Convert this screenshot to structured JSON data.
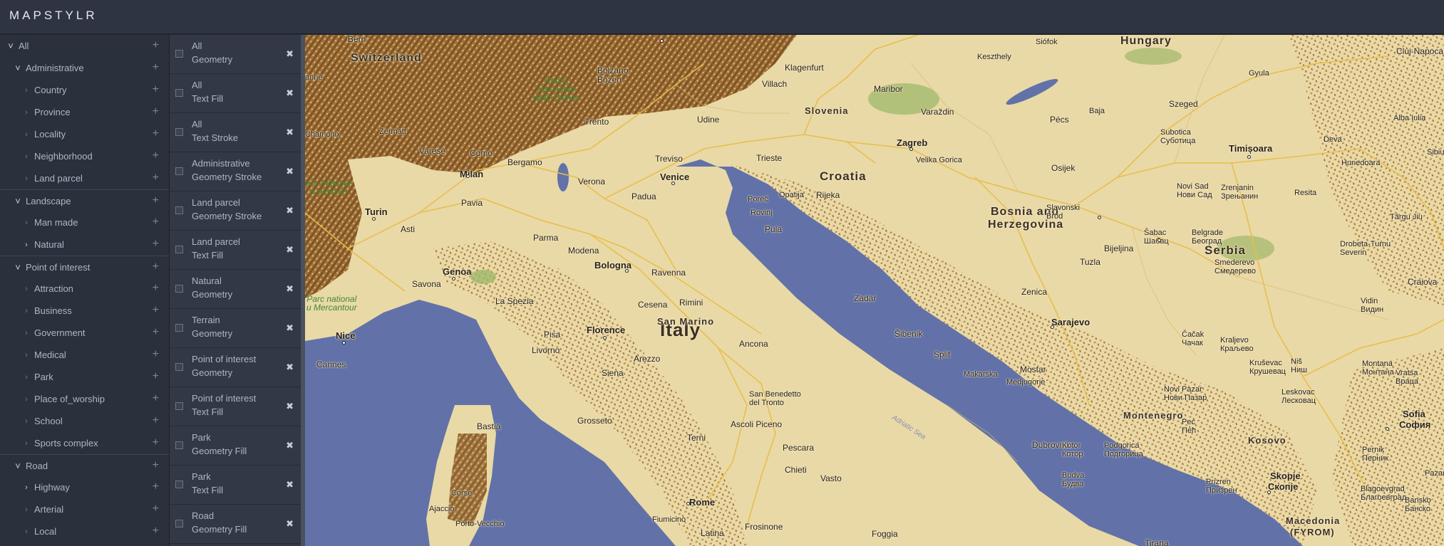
{
  "app": {
    "title": "MAPSTYLR"
  },
  "tree": [
    {
      "label": "All",
      "level": 0,
      "expanded": true,
      "sep": false
    },
    {
      "label": "Administrative",
      "level": 1,
      "expanded": true,
      "sep": false
    },
    {
      "label": "Country",
      "level": 2,
      "expanded": false,
      "sep": false
    },
    {
      "label": "Province",
      "level": 2,
      "expanded": false,
      "sep": false
    },
    {
      "label": "Locality",
      "level": 2,
      "expanded": false,
      "sep": false
    },
    {
      "label": "Neighborhood",
      "level": 2,
      "expanded": false,
      "sep": false
    },
    {
      "label": "Land parcel",
      "level": 2,
      "expanded": false,
      "sep": false
    },
    {
      "label": "Landscape",
      "level": 1,
      "expanded": true,
      "sep": true
    },
    {
      "label": "Man made",
      "level": 2,
      "expanded": false,
      "sep": false
    },
    {
      "label": "Natural",
      "level": 2,
      "expanded": false,
      "bright": true,
      "sep": false
    },
    {
      "label": "Point of interest",
      "level": 1,
      "expanded": true,
      "sep": true
    },
    {
      "label": "Attraction",
      "level": 2,
      "expanded": false,
      "sep": false
    },
    {
      "label": "Business",
      "level": 2,
      "expanded": false,
      "sep": false
    },
    {
      "label": "Government",
      "level": 2,
      "expanded": false,
      "sep": false
    },
    {
      "label": "Medical",
      "level": 2,
      "expanded": false,
      "sep": false
    },
    {
      "label": "Park",
      "level": 2,
      "expanded": false,
      "sep": false
    },
    {
      "label": "Place of_worship",
      "level": 2,
      "expanded": false,
      "sep": false
    },
    {
      "label": "School",
      "level": 2,
      "expanded": false,
      "sep": false
    },
    {
      "label": "Sports complex",
      "level": 2,
      "expanded": false,
      "sep": false
    },
    {
      "label": "Road",
      "level": 1,
      "expanded": true,
      "sep": true
    },
    {
      "label": "Highway",
      "level": 2,
      "expanded": false,
      "bright": true,
      "sep": false
    },
    {
      "label": "Arterial",
      "level": 2,
      "expanded": false,
      "sep": false
    },
    {
      "label": "Local",
      "level": 2,
      "expanded": false,
      "sep": false
    }
  ],
  "rules": [
    {
      "feature": "All",
      "element": "Geometry"
    },
    {
      "feature": "All",
      "element": "Text Fill"
    },
    {
      "feature": "All",
      "element": "Text Stroke"
    },
    {
      "feature": "Administrative",
      "element": "Geometry Stroke"
    },
    {
      "feature": "Land parcel",
      "element": "Geometry Stroke"
    },
    {
      "feature": "Land parcel",
      "element": "Text Fill"
    },
    {
      "feature": "Natural",
      "element": "Geometry"
    },
    {
      "feature": "Terrain",
      "element": "Geometry"
    },
    {
      "feature": "Point of interest",
      "element": "Geometry"
    },
    {
      "feature": "Point of interest",
      "element": "Text Fill"
    },
    {
      "feature": "Park",
      "element": "Geometry Fill"
    },
    {
      "feature": "Park",
      "element": "Text Fill"
    },
    {
      "feature": "Road",
      "element": "Geometry Fill"
    }
  ],
  "map": {
    "colors": {
      "land": "#e9d9a6",
      "water": "#6272a8",
      "terrain": "#9a6a36",
      "park": "#9fb86a",
      "road": "#e8bd4a"
    },
    "labels": {
      "hungary": "Hungary",
      "switzerland": "Switzerland",
      "slovenia": "Slovenia",
      "croatia": "Croatia",
      "bosnia1": "Bosnia and",
      "bosnia2": "Herzegovina",
      "serbia": "Serbia",
      "italy": "Italy",
      "montenegro": "Montenegro",
      "kosovo": "Kosovo",
      "macedonia1": "Macedonia",
      "macedonia2": "(FYROM)",
      "sanmarino": "San Marino",
      "bern": "Bern",
      "milan": "Milan",
      "turin": "Turin",
      "venice": "Venice",
      "genoa": "Genoa",
      "bologna": "Bologna",
      "florence": "Florence",
      "rome": "Rome",
      "nice": "Nice",
      "zagreb": "Zagreb",
      "sarajevo": "Sarajevo",
      "skopje": "Skopje",
      "skopje_cyr": "Скопје",
      "sofia": "Sofia",
      "sofia_cyr": "София",
      "timisoara": "Timișoara",
      "bastia": "Bastia",
      "ajaccio": "Ajaccio",
      "pisa": "Pisa",
      "livorno": "Livorno",
      "padua": "Padua",
      "verona": "Verona",
      "trento": "Trento",
      "bolzano": "Bolzano\nBozen",
      "como": "Como",
      "bergamo": "Bergamo",
      "varese": "Varese",
      "pavia": "Pavia",
      "asti": "Asti",
      "parma": "Parma",
      "modena": "Modena",
      "ravenna": "Ravenna",
      "rimini": "Rimini",
      "cesena": "Cesena",
      "ancona": "Ancona",
      "arezzo": "Arezzo",
      "siena": "Siena",
      "grosseto": "Grosseto",
      "terni": "Terni",
      "pescara": "Pescara",
      "chieti": "Chieti",
      "vasto": "Vasto",
      "foggia": "Foggia",
      "latina": "Latina",
      "frosinone": "Frosinone",
      "fiumicino": "Fiumicino",
      "trieste": "Trieste",
      "treviso": "Treviso",
      "udine": "Udine",
      "klagenfurt": "Klagenfurt",
      "villach": "Villach",
      "maribor": "Maribor",
      "varazdin": "Varaždin",
      "rijeka": "Rijeka",
      "pula": "Pula",
      "porec": "Poreč",
      "rovinj": "Rovinj",
      "opatija": "Opatija",
      "zadar": "Zadar",
      "sibenik": "Šibenik",
      "split": "Split",
      "makarska": "Makarska",
      "mostar": "Mostar",
      "medjugorje": "Medjugorje",
      "dubrovnik": "Dubrovnik",
      "budva": "Budva\nБудва",
      "kotor": "Kotor\nКотор",
      "podgorica": "Podgorica\nПодгорица",
      "zenica": "Zenica",
      "tuzla": "Tuzla",
      "bijeljina": "Bijeljina",
      "sabac": "Šabac\nШабац",
      "belgrade": "Belgrade\nБеоград",
      "smederevo": "Smederevo\nСмедерево",
      "novisad": "Novi Sad\nНови Сад",
      "zrenjanin": "Zrenjanin\nЗрењанин",
      "subotica": "Subotica\nСуботица",
      "szeged": "Szeged",
      "pecs": "Pécs",
      "osijek": "Osijek",
      "slavonski": "Slavonski\nBrod",
      "velikagorica": "Velika Gorica",
      "keszthely": "Keszthely",
      "siofok": "Siófok",
      "baja": "Baja",
      "gyula": "Gyula",
      "clujnapoca": "Cluj-Napoca",
      "albaiulia": "Alba Iulia",
      "deva": "Deva",
      "hunedoara": "Hunedoara",
      "resita": "Resita",
      "targujiu": "Târgu Jiu",
      "drobeta": "Drobeta-Turnu\nSeverin",
      "craiova": "Craiova",
      "vidin": "Vidin\nВидин",
      "montana": "Montana\nМонтана",
      "vratsa": "Vratsa\nВраца",
      "pernik": "Pernik\nПерник",
      "blagoevgrad": "Blagoevgrad\nБлагоевград",
      "bansko": "Bansko\nБанско",
      "kraljevo": "Kraljevo\nКраљево",
      "cacak": "Čačak\nЧачак",
      "krusevac": "Kruševac\nКрушевац",
      "nis": "Niš\nНиш",
      "leskovac": "Leskovac\nЛесковац",
      "novipazar": "Novi Pazar\nНови Пазар",
      "pec": "Peć\nПећ",
      "prizren": "Prizren\nПризрен",
      "tirana": "Tirana",
      "zermatt": "Zermatt",
      "chamonix": "Chamonix",
      "cannes": "Cannes",
      "laspezia": "La Spezia",
      "savona": "Savona",
      "sanbenedetto": "San Benedetto\ndel Tronto",
      "ascoli": "Ascoli Piceno",
      "portovecchio": "Porto-Vecchio",
      "corse": "Corse",
      "sibiu": "Sibiu",
      "pazardz": "Pazardž",
      "lugano": "Lugano",
      "annecy": "anne",
      "stelvio": "Parco\nNazionale\ndello Stelvio",
      "vanoise": "arc national\na Vanoise",
      "mercantour": "Parc national\nu Mercantour",
      "adriatic": "Adriatic Sea"
    }
  }
}
